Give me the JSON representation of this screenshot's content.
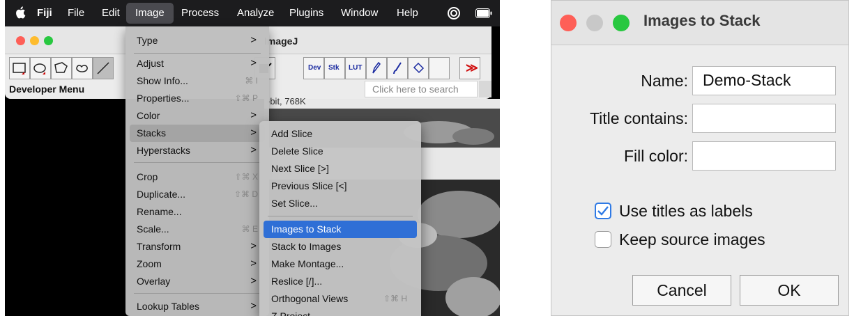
{
  "menubar": {
    "app": "Fiji",
    "items": [
      "File",
      "Edit",
      "Image",
      "Process",
      "Analyze",
      "Plugins",
      "Window",
      "Help"
    ],
    "active": "Image"
  },
  "imagej_window": {
    "title": "ImageJ",
    "status": "Developer Menu",
    "search_placeholder": "Click here to search",
    "tool_labels": {
      "dev": "Dev",
      "stk": "Stk",
      "lut": "LUT",
      "more": "≫"
    },
    "image_info_fragment": "-bit, 768K"
  },
  "image_menu": {
    "items": [
      {
        "label": "Type",
        "arrow": true
      },
      {
        "label": "Adjust",
        "arrow": true
      },
      {
        "label": "Show Info...",
        "shortcut": "⌘ I"
      },
      {
        "label": "Properties...",
        "shortcut": "⇧⌘ P"
      },
      {
        "label": "Color",
        "arrow": true
      },
      {
        "label": "Stacks",
        "arrow": true,
        "highlighted": true
      },
      {
        "label": "Hyperstacks",
        "arrow": true
      },
      {
        "label": "Crop",
        "shortcut": "⇧⌘ X"
      },
      {
        "label": "Duplicate...",
        "shortcut": "⇧⌘ D"
      },
      {
        "label": "Rename..."
      },
      {
        "label": "Scale...",
        "shortcut": "⌘ E"
      },
      {
        "label": "Transform",
        "arrow": true
      },
      {
        "label": "Zoom",
        "arrow": true
      },
      {
        "label": "Overlay",
        "arrow": true
      },
      {
        "label": "Lookup Tables",
        "arrow": true
      }
    ]
  },
  "stacks_submenu": {
    "items": [
      {
        "label": "Add Slice"
      },
      {
        "label": "Delete Slice"
      },
      {
        "label": "Next Slice [>]"
      },
      {
        "label": "Previous Slice [<]"
      },
      {
        "label": "Set Slice..."
      },
      {
        "label": "Images to Stack",
        "selected": true
      },
      {
        "label": "Stack to Images"
      },
      {
        "label": "Make Montage..."
      },
      {
        "label": "Reslice [/]..."
      },
      {
        "label": "Orthogonal Views",
        "shortcut": "⇧⌘ H"
      },
      {
        "label": "Z Project..."
      }
    ]
  },
  "dialog": {
    "title": "Images to Stack",
    "name_label": "Name:",
    "name_value": "Demo-Stack",
    "title_contains_label": "Title contains:",
    "title_contains_value": "",
    "fill_color_label": "Fill color:",
    "fill_color_value": "",
    "use_titles_label": "Use titles as labels",
    "use_titles_checked": true,
    "keep_source_label": "Keep source images",
    "keep_source_checked": false,
    "cancel_label": "Cancel",
    "ok_label": "OK"
  },
  "colors": {
    "selection_blue": "#2f6fd6",
    "traffic_red": "#fe5f57",
    "traffic_yellow": "#febc2e",
    "traffic_green": "#28c840",
    "traffic_gray": "#c8c8c8"
  }
}
